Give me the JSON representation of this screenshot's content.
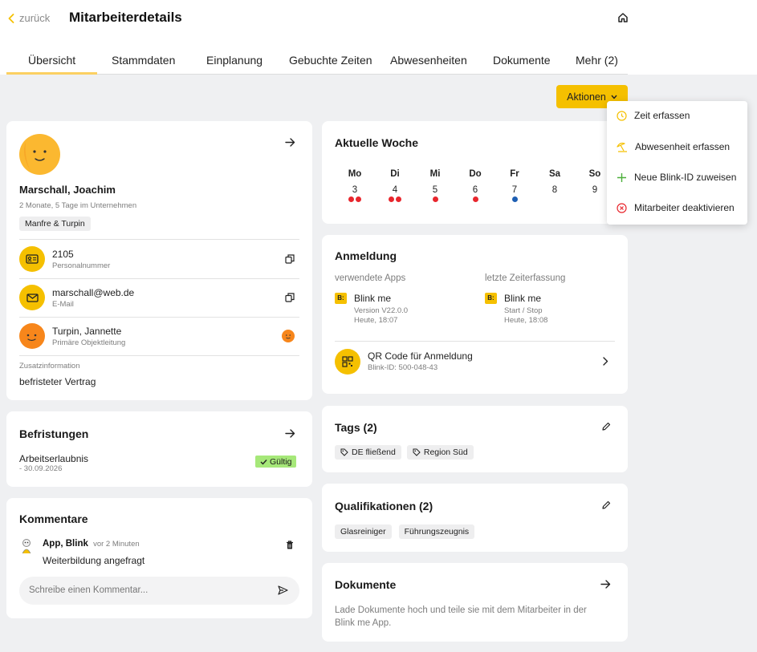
{
  "header": {
    "back_label": "zurück",
    "title": "Mitarbeiterdetails"
  },
  "tabs": [
    "Übersicht",
    "Stammdaten",
    "Einplanung",
    "Gebuchte Zeiten",
    "Abwesenheiten",
    "Dokumente",
    "Mehr (2)"
  ],
  "actions": {
    "button_label": "Aktionen",
    "menu": [
      "Zeit erfassen",
      "Abwesenheit erfassen",
      "Neue Blink-ID zuweisen",
      "Mitarbeiter deaktivieren"
    ]
  },
  "profile": {
    "name": "Marschall, Joachim",
    "tenure": "2 Monate, 5 Tage im Unternehmen",
    "company_tag": "Manfre & Turpin",
    "personnel_number": "2105",
    "personnel_number_label": "Personalnummer",
    "email": "marschall@web.de",
    "email_label": "E-Mail",
    "manager": "Turpin, Jannette",
    "manager_label": "Primäre Objektleitung",
    "extra_label": "Zusatzinformation",
    "extra_value": "befristeter Vertrag"
  },
  "limits": {
    "title": "Befristungen",
    "item": "Arbeitserlaubnis",
    "date": "- 30.09.2026",
    "status": "Gültig"
  },
  "comments": {
    "title": "Kommentare",
    "author": "App, Blink",
    "time": "vor 2 Minuten",
    "text": "Weiterbildung angefragt",
    "placeholder": "Schreibe einen Kommentar..."
  },
  "week": {
    "title": "Aktuelle Woche",
    "days": [
      {
        "name": "Mo",
        "date": "3",
        "dots": [
          "#e8262d",
          "#e8262d"
        ]
      },
      {
        "name": "Di",
        "date": "4",
        "dots": [
          "#e8262d",
          "#e8262d"
        ]
      },
      {
        "name": "Mi",
        "date": "5",
        "dots": [
          "#e8262d"
        ]
      },
      {
        "name": "Do",
        "date": "6",
        "dots": [
          "#e8262d"
        ]
      },
      {
        "name": "Fr",
        "date": "7",
        "dots": [
          "#1e5fb3"
        ]
      },
      {
        "name": "Sa",
        "date": "8",
        "dots": []
      },
      {
        "name": "So",
        "date": "9",
        "dots": []
      }
    ]
  },
  "login": {
    "title": "Anmeldung",
    "apps_label": "verwendete Apps",
    "app_name": "Blink me",
    "app_version": "Version V22.0.0",
    "app_time": "Heute, 18:07",
    "last_label": "letzte Zeiterfassung",
    "last_name": "Blink me",
    "last_action": "Start / Stop",
    "last_time": "Heute, 18:08",
    "qr_label": "QR Code für Anmeldung",
    "qr_id": "Blink-ID: 500-048-43"
  },
  "tags": {
    "title": "Tags (2)",
    "items": [
      "DE fließend",
      "Region Süd"
    ]
  },
  "qualifications": {
    "title": "Qualifikationen (2)",
    "items": [
      "Glasreiniger",
      "Führungszeugnis"
    ]
  },
  "documents": {
    "title": "Dokumente",
    "text": "Lade Dokumente hoch und teile sie mit dem Mitarbeiter in der Blink me App."
  },
  "colors": {
    "accent": "#f5c000",
    "status_ok": "#a6e879",
    "dot_red": "#e8262d",
    "dot_blue": "#1e5fb3"
  }
}
